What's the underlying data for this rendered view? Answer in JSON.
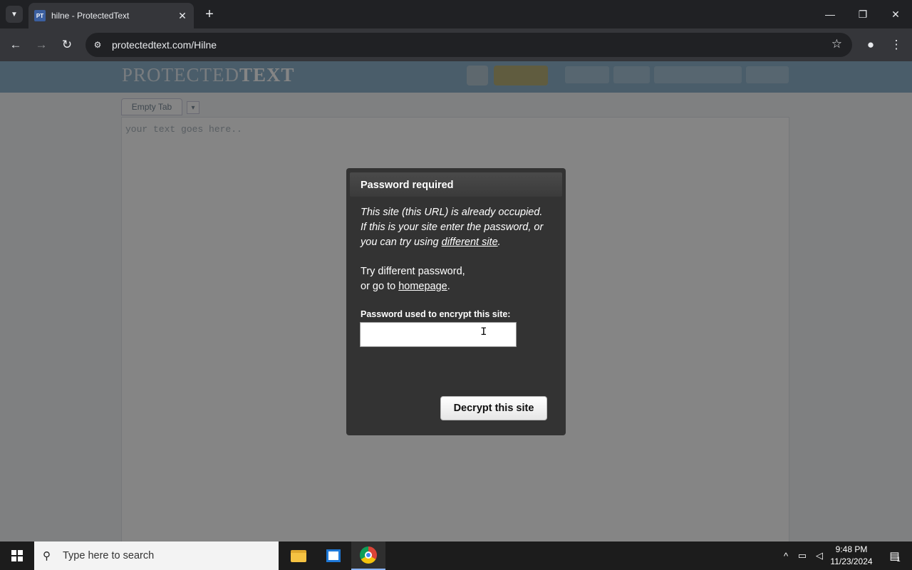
{
  "browser": {
    "tab_title": "hilne - ProtectedText",
    "favicon_text": "PT",
    "url": "protectedtext.com/Hilne",
    "icons": {
      "tab_search": "chevron-down-icon",
      "tab_close": "close-icon",
      "new_tab": "plus-icon",
      "minimize": "minimize-icon",
      "restore": "restore-icon",
      "close": "close-icon",
      "back": "back-arrow-icon",
      "forward": "forward-arrow-icon",
      "reload": "reload-icon",
      "site_info": "site-info-icon",
      "bookmark": "star-icon",
      "profile": "profile-icon",
      "menu": "kebab-menu-icon"
    }
  },
  "site": {
    "logo_light": "PROTECTED",
    "logo_bold": "TEXT",
    "tab_label": "Empty Tab",
    "textarea_placeholder": "your text goes here..",
    "header_colors": {
      "bar": "#8fb3cc"
    }
  },
  "modal": {
    "title": "Password required",
    "intro_line1": "This site (this URL) is already occupied.",
    "intro_line2": "If this is your site enter the password, or",
    "intro_line3_prefix": "you can try using ",
    "intro_link": "different site",
    "intro_line3_suffix": ".",
    "retry_line1": "Try different password,",
    "retry_line2_prefix": "or go to ",
    "retry_link": "homepage",
    "retry_line2_suffix": ".",
    "password_label": "Password used to encrypt this site:",
    "password_value": "",
    "decrypt_button": "Decrypt this site"
  },
  "taskbar": {
    "search_placeholder": "Type here to search",
    "time": "9:48 PM",
    "date": "11/23/2024",
    "notification_count": "1",
    "apps": [
      "file-explorer-icon",
      "store-icon",
      "chrome-icon"
    ]
  }
}
